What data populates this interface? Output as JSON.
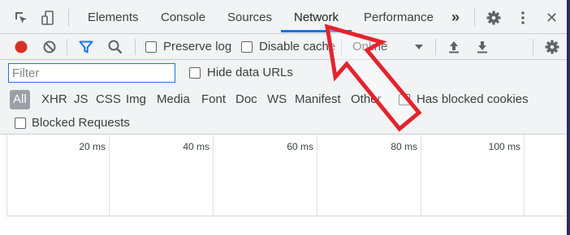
{
  "tabs": [
    {
      "label": "Elements"
    },
    {
      "label": "Console"
    },
    {
      "label": "Sources"
    },
    {
      "label": "Network",
      "active": true
    },
    {
      "label": "Performance"
    }
  ],
  "tabbar": {
    "more_glyph": "»",
    "close_glyph": "✕"
  },
  "toolbar": {
    "preserve_log_label": "Preserve log",
    "disable_cache_label": "Disable cache",
    "throttle_value": "Online",
    "record_color": "#d93025",
    "filter_icon_color": "#1a73e8"
  },
  "filter": {
    "placeholder": "Filter",
    "hide_data_urls_label": "Hide data URLs",
    "types": [
      "All",
      "XHR",
      "JS",
      "CSS",
      "Img",
      "Media",
      "Font",
      "Doc",
      "WS",
      "Manifest",
      "Other"
    ],
    "selected_type": "All",
    "has_blocked_cookies_label": "Has blocked cookies",
    "blocked_requests_label": "Blocked Requests"
  },
  "timeline": {
    "ticks": [
      "20 ms",
      "40 ms",
      "60 ms",
      "80 ms",
      "100 ms"
    ]
  },
  "annotation": {
    "arrow_color": "#e3242b",
    "points_to": "tab-network"
  }
}
